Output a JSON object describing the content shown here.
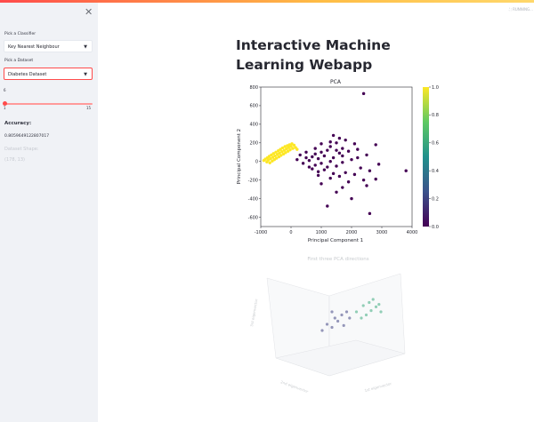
{
  "sidebar": {
    "classifier_label": "Pick a Classifier",
    "classifier_value": "Key Nearest Neighbour",
    "dataset_label": "Pick a Dataset",
    "dataset_value": "Diabetes Dataset",
    "slider_value": "6",
    "slider_min": "1",
    "slider_max": "15",
    "slider_fraction": 0.0,
    "accuracy_label": "Accuracy:",
    "accuracy_value": "0.8059649122807017",
    "shape_label": "Dataset Shape:",
    "shape_value": "(178, 13)"
  },
  "header": {
    "menu_label": "RUNNING..."
  },
  "main": {
    "title": "Interactive Machine Learning Webapp"
  },
  "chart_data": [
    {
      "type": "scatter",
      "title": "PCA",
      "xlabel": "Principal Component 1",
      "ylabel": "Principal Component 2",
      "xlim": [
        -1000,
        4000
      ],
      "ylim": [
        -700,
        800
      ],
      "xticks": [
        "-1000",
        "0",
        "1000",
        "2000",
        "3000",
        "4000"
      ],
      "yticks": [
        "800",
        "600",
        "400",
        "200",
        "0",
        "-200",
        "-400",
        "-600"
      ],
      "colorbar_ticks": [
        "1.0",
        "0.8",
        "0.6",
        "0.4",
        "0.2",
        "0.0"
      ],
      "colorbar_range": [
        0,
        1
      ],
      "series": [
        {
          "color_value": 0,
          "points": [
            [
              2400,
              730
            ],
            [
              1400,
              280
            ],
            [
              1600,
              250
            ],
            [
              1800,
              230
            ],
            [
              1500,
              200
            ],
            [
              2100,
              190
            ],
            [
              2800,
              180
            ],
            [
              1300,
              160
            ],
            [
              1700,
              140
            ],
            [
              2200,
              130
            ],
            [
              1200,
              120
            ],
            [
              1900,
              110
            ],
            [
              1000,
              100
            ],
            [
              1600,
              90
            ],
            [
              800,
              80
            ],
            [
              2500,
              70
            ],
            [
              1100,
              60
            ],
            [
              700,
              50
            ],
            [
              1400,
              40
            ],
            [
              900,
              30
            ],
            [
              2000,
              20
            ],
            [
              600,
              10
            ],
            [
              1300,
              0
            ],
            [
              1700,
              -10
            ],
            [
              1000,
              -20
            ],
            [
              2900,
              -30
            ],
            [
              800,
              -40
            ],
            [
              1500,
              -50
            ],
            [
              1200,
              -60
            ],
            [
              2300,
              -70
            ],
            [
              700,
              -80
            ],
            [
              1100,
              -90
            ],
            [
              2600,
              -100
            ],
            [
              900,
              -110
            ],
            [
              1800,
              -120
            ],
            [
              1400,
              -130
            ],
            [
              2100,
              -140
            ],
            [
              1600,
              -160
            ],
            [
              1300,
              -180
            ],
            [
              2400,
              -200
            ],
            [
              1900,
              -220
            ],
            [
              1000,
              -240
            ],
            [
              2500,
              -260
            ],
            [
              1700,
              -280
            ],
            [
              1500,
              -330
            ],
            [
              2000,
              -400
            ],
            [
              1200,
              -480
            ],
            [
              2600,
              -560
            ],
            [
              3800,
              -100
            ],
            [
              300,
              70
            ],
            [
              500,
              40
            ],
            [
              400,
              -20
            ],
            [
              600,
              -60
            ],
            [
              200,
              20
            ],
            [
              500,
              100
            ],
            [
              800,
              140
            ],
            [
              1000,
              190
            ],
            [
              1300,
              210
            ],
            [
              1500,
              120
            ],
            [
              2200,
              40
            ],
            [
              1700,
              60
            ],
            [
              900,
              -150
            ],
            [
              2800,
              -190
            ]
          ]
        },
        {
          "color_value": 1,
          "points": [
            [
              -900,
              10
            ],
            [
              -850,
              25
            ],
            [
              -800,
              -5
            ],
            [
              -780,
              40
            ],
            [
              -750,
              15
            ],
            [
              -720,
              55
            ],
            [
              -700,
              -15
            ],
            [
              -680,
              30
            ],
            [
              -650,
              70
            ],
            [
              -620,
              5
            ],
            [
              -600,
              45
            ],
            [
              -580,
              85
            ],
            [
              -550,
              20
            ],
            [
              -530,
              60
            ],
            [
              -500,
              100
            ],
            [
              -480,
              35
            ],
            [
              -450,
              75
            ],
            [
              -420,
              115
            ],
            [
              -400,
              50
            ],
            [
              -380,
              90
            ],
            [
              -350,
              130
            ],
            [
              -330,
              65
            ],
            [
              -300,
              105
            ],
            [
              -280,
              145
            ],
            [
              -250,
              80
            ],
            [
              -220,
              120
            ],
            [
              -200,
              160
            ],
            [
              -180,
              95
            ],
            [
              -150,
              135
            ],
            [
              -120,
              170
            ],
            [
              -100,
              110
            ],
            [
              -80,
              150
            ],
            [
              -50,
              180
            ],
            [
              -30,
              125
            ],
            [
              0,
              160
            ],
            [
              30,
              190
            ],
            [
              60,
              140
            ],
            [
              100,
              175
            ],
            [
              150,
              150
            ],
            [
              200,
              130
            ]
          ]
        }
      ]
    },
    {
      "type": "scatter",
      "title": "First three PCA directions",
      "xlabel": "1st eigenvector",
      "ylabel": "2nd eigenvector",
      "zlabel": "3rd eigenvector",
      "series": [
        {
          "color_value": 0.2,
          "points": [
            [
              0.2,
              0.3
            ],
            [
              0.25,
              0.4
            ],
            [
              0.3,
              0.35
            ],
            [
              0.33,
              0.5
            ],
            [
              0.36,
              0.45
            ],
            [
              0.4,
              0.55
            ],
            [
              0.42,
              0.38
            ],
            [
              0.45,
              0.6
            ],
            [
              0.48,
              0.5
            ],
            [
              0.3,
              0.6
            ]
          ]
        },
        {
          "color_value": 0.6,
          "points": [
            [
              0.55,
              0.6
            ],
            [
              0.6,
              0.5
            ],
            [
              0.62,
              0.7
            ],
            [
              0.65,
              0.55
            ],
            [
              0.68,
              0.75
            ],
            [
              0.7,
              0.62
            ],
            [
              0.72,
              0.8
            ],
            [
              0.75,
              0.68
            ],
            [
              0.78,
              0.72
            ],
            [
              0.8,
              0.6
            ]
          ]
        }
      ]
    }
  ]
}
